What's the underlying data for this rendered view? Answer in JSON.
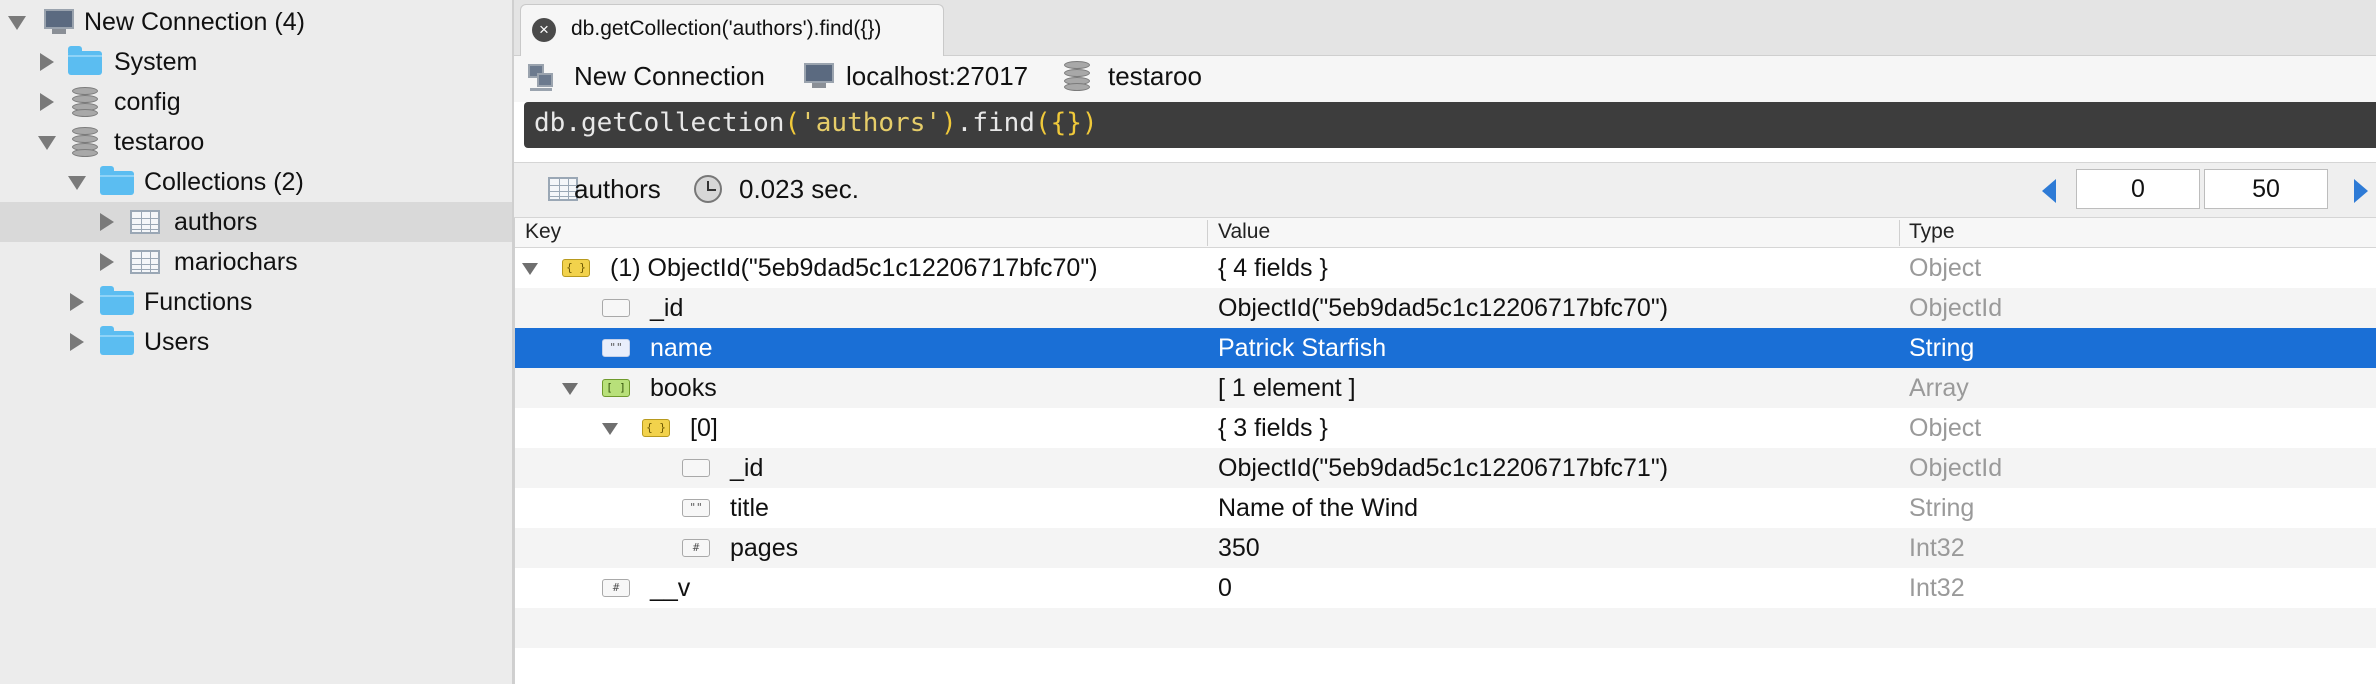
{
  "sidebar": {
    "connection_label": "New Connection (4)",
    "items": {
      "system": "System",
      "config": "config",
      "testaroo": "testaroo",
      "collections": "Collections (2)",
      "authors": "authors",
      "mariochars": "mariochars",
      "functions": "Functions",
      "users": "Users"
    }
  },
  "tab": {
    "label": "db.getCollection('authors').find({})",
    "close_glyph": "×"
  },
  "connection_bar": {
    "connection": "New Connection",
    "host": "localhost:27017",
    "database": "testaroo"
  },
  "query": {
    "db": "db",
    "dot1": ".",
    "method": "getCollection",
    "open_paren": "(",
    "collection": "'authors'",
    "close_paren": ")",
    "dot2": ".",
    "find": "find",
    "find_open": "(",
    "braces": "{}",
    "find_close": ")"
  },
  "result_bar": {
    "collection": "authors",
    "time": "0.023 sec.",
    "page_start": "0",
    "page_size": "50"
  },
  "grid": {
    "columns": {
      "key": "Key",
      "value": "Value",
      "type": "Type"
    },
    "rows": [
      {
        "key": "(1) ObjectId(\"5eb9dad5c1c12206717bfc70\")",
        "value": "{ 4 fields }",
        "type": "Object",
        "icon": "object-icon"
      },
      {
        "key": "_id",
        "value": "ObjectId(\"5eb9dad5c1c12206717bfc70\")",
        "type": "ObjectId",
        "icon": "objectid-icon"
      },
      {
        "key": "name",
        "value": "Patrick Starfish",
        "type": "String",
        "icon": "string-icon",
        "icon_glyph": "\"\""
      },
      {
        "key": "books",
        "value": "[ 1 element ]",
        "type": "Array",
        "icon": "array-icon"
      },
      {
        "key": "[0]",
        "value": "{ 3 fields }",
        "type": "Object",
        "icon": "object-icon"
      },
      {
        "key": "_id",
        "value": "ObjectId(\"5eb9dad5c1c12206717bfc71\")",
        "type": "ObjectId",
        "icon": "objectid-icon"
      },
      {
        "key": "title",
        "value": "Name of the Wind",
        "type": "String",
        "icon": "string-icon",
        "icon_glyph": "\"\""
      },
      {
        "key": "pages",
        "value": "350",
        "type": "Int32",
        "icon": "number-icon",
        "icon_glyph": "#"
      },
      {
        "key": "__v",
        "value": "0",
        "type": "Int32",
        "icon": "number-icon",
        "icon_glyph": "#"
      }
    ]
  },
  "colors": {
    "selection": "#1a6fd6",
    "folder": "#5bbdf1",
    "query_bg": "#3d3d3d",
    "query_string": "#e6cd69",
    "pager_arrow": "#2e7bd6"
  }
}
